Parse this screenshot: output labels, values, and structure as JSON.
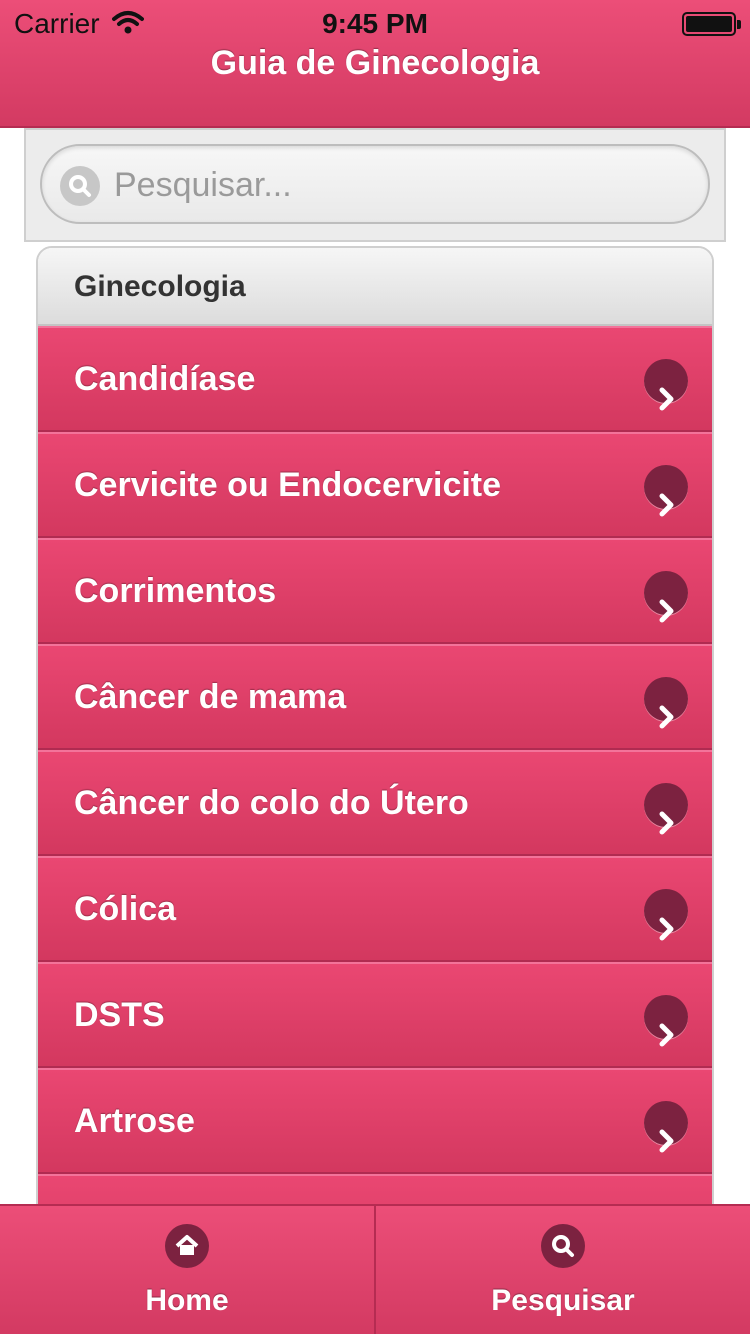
{
  "status": {
    "carrier": "Carrier",
    "time": "9:45 PM"
  },
  "header": {
    "title": "Guia de Ginecologia"
  },
  "search": {
    "placeholder": "Pesquisar..."
  },
  "list": {
    "section_title": "Ginecologia",
    "items": [
      {
        "label": "Candidíase"
      },
      {
        "label": "Cervicite ou Endocervicite"
      },
      {
        "label": "Corrimentos"
      },
      {
        "label": "Câncer de mama"
      },
      {
        "label": "Câncer do colo do Útero"
      },
      {
        "label": "Cólica"
      },
      {
        "label": "DSTS"
      },
      {
        "label": "Artrose"
      },
      {
        "label": ""
      }
    ]
  },
  "tabbar": {
    "tabs": [
      {
        "label": "Home",
        "icon": "home-icon"
      },
      {
        "label": "Pesquisar",
        "icon": "search-icon"
      }
    ]
  },
  "colors": {
    "accent": "#e24268",
    "chevron": "#7c2240"
  }
}
